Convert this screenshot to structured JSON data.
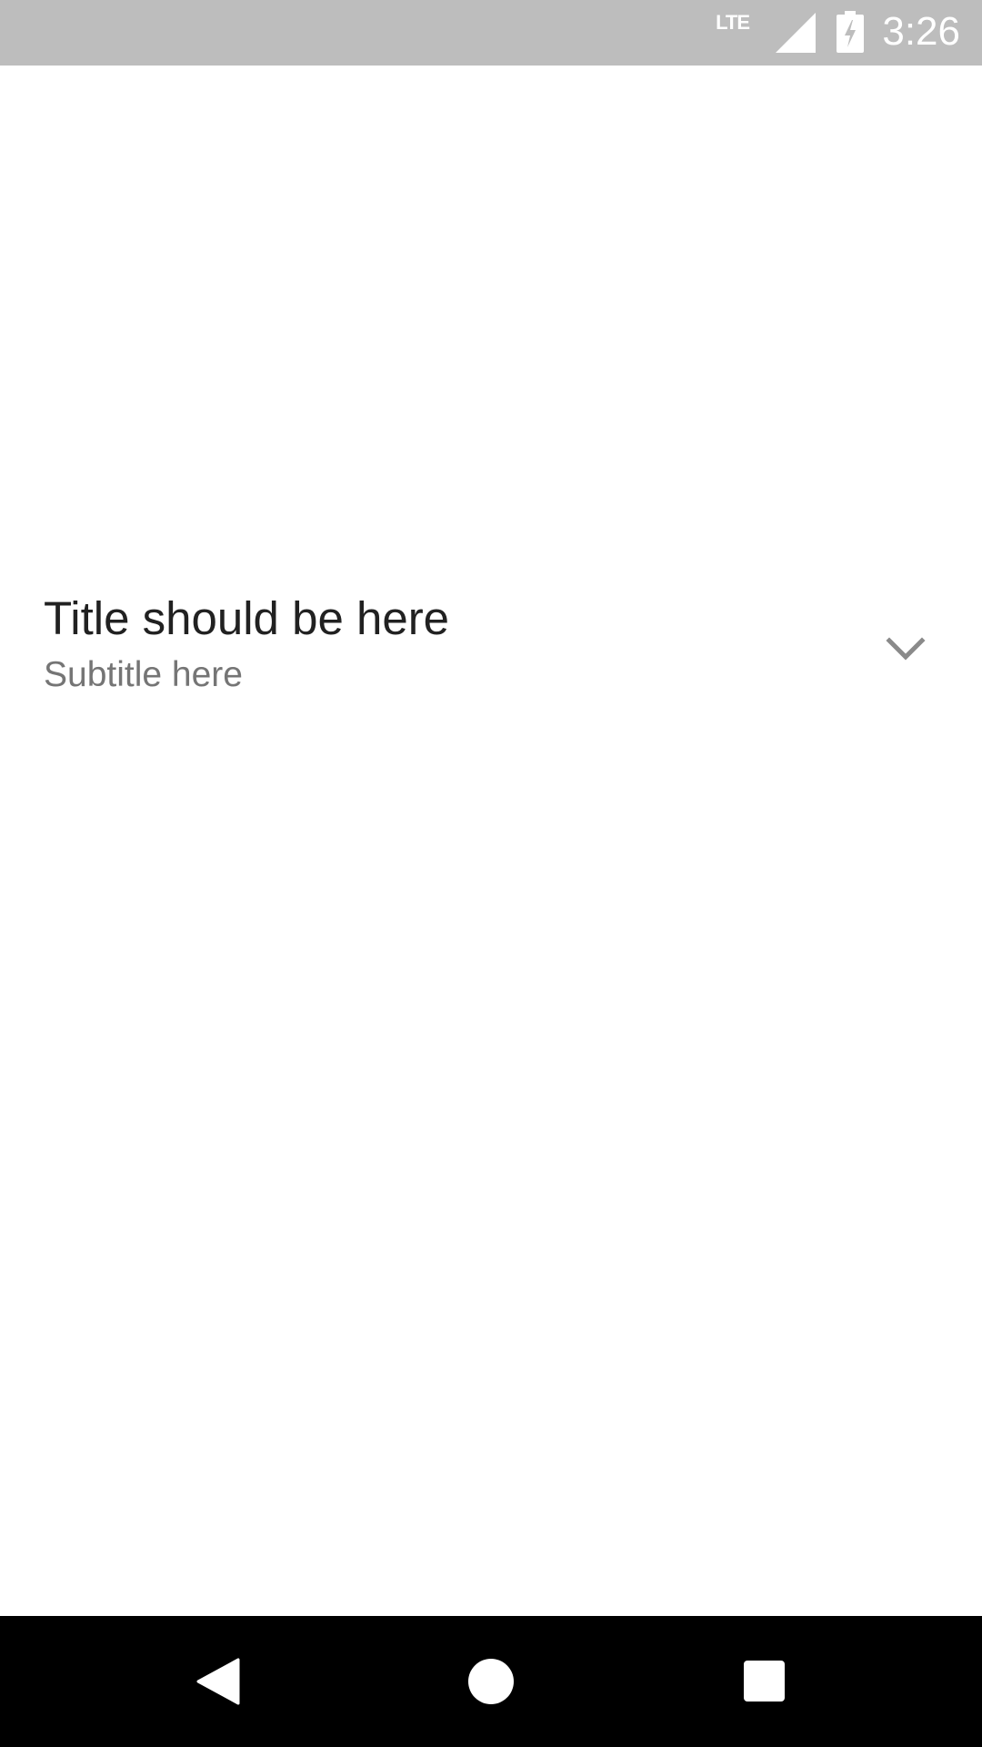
{
  "status_bar": {
    "network_label": "LTE",
    "time": "3:26",
    "icons": [
      "lte-icon",
      "signal-icon",
      "battery-charging-icon"
    ]
  },
  "list_item": {
    "title": "Title should be here",
    "subtitle": "Subtitle here",
    "icon": "chevron-down-icon"
  },
  "nav_bar": {
    "icons": [
      "back-icon",
      "home-icon",
      "recents-icon"
    ]
  },
  "colors": {
    "status_bar_bg": "#bdbdbd",
    "title_text": "#212121",
    "subtitle_text": "#757575",
    "icon_gray": "#8a8a8a",
    "nav_bar_bg": "#000000"
  }
}
